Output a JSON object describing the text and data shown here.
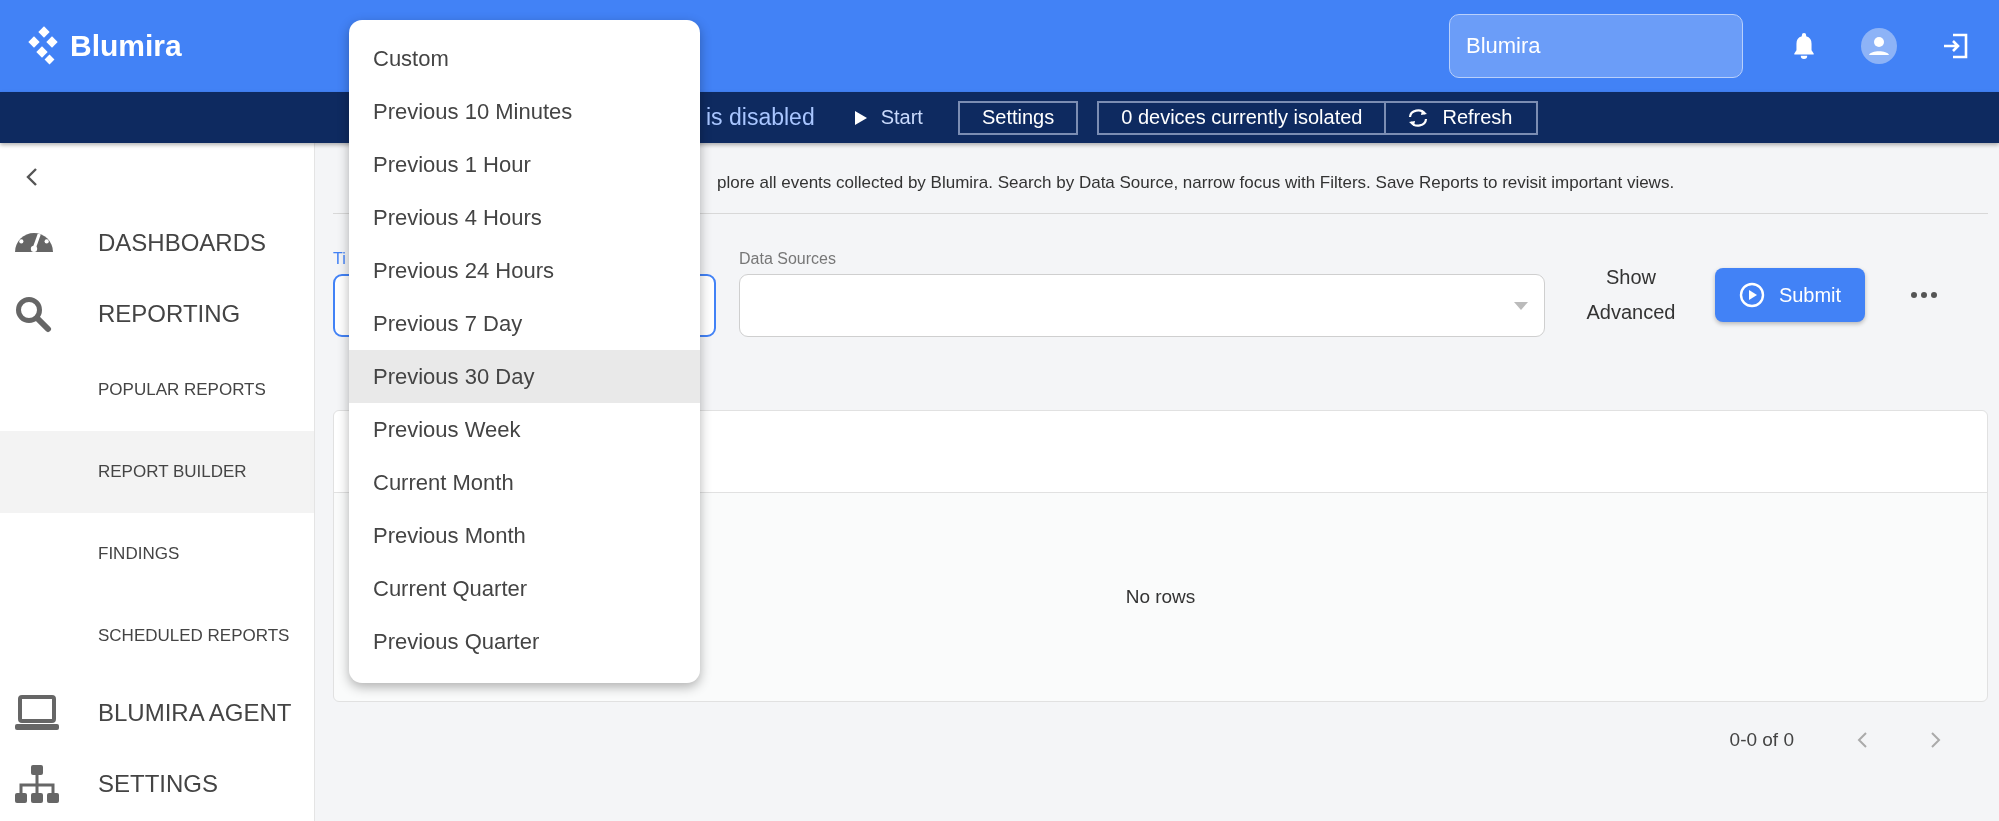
{
  "header": {
    "logo_text": "Blumira",
    "org_field": {
      "value": "Blumira"
    }
  },
  "status_bar": {
    "message": "is disabled",
    "start": "Start",
    "settings": "Settings",
    "isolated": "0 devices currently isolated",
    "refresh": "Refresh"
  },
  "sidebar": {
    "items": [
      {
        "label": "DASHBOARDS",
        "selected": false
      },
      {
        "label": "REPORTING",
        "selected": false,
        "children": [
          {
            "label": "POPULAR REPORTS",
            "selected": false
          },
          {
            "label": "REPORT BUILDER",
            "selected": true
          },
          {
            "label": "FINDINGS",
            "selected": false
          },
          {
            "label": "SCHEDULED REPORTS",
            "selected": false
          }
        ]
      },
      {
        "label": "BLUMIRA AGENT",
        "selected": false
      },
      {
        "label": "SETTINGS",
        "selected": false
      }
    ]
  },
  "description": "plore all events collected by Blumira. Search by Data Source, narrow focus with Filters. Save Reports to revisit important views.",
  "filters": {
    "time_label": "Ti",
    "data_sources": {
      "label": "Data Sources"
    },
    "show_advanced": "Show Advanced",
    "submit": "Submit"
  },
  "table": {
    "empty_text": "No rows"
  },
  "pagination": {
    "range": "0-0 of 0"
  },
  "time_menu": {
    "items": [
      {
        "label": "Custom",
        "selected": false
      },
      {
        "label": "Previous 10 Minutes",
        "selected": false
      },
      {
        "label": "Previous 1 Hour",
        "selected": false
      },
      {
        "label": "Previous 4 Hours",
        "selected": false
      },
      {
        "label": "Previous 24 Hours",
        "selected": false
      },
      {
        "label": "Previous 7 Day",
        "selected": false
      },
      {
        "label": "Previous 30 Day",
        "selected": true
      },
      {
        "label": "Previous Week",
        "selected": false
      },
      {
        "label": "Current Month",
        "selected": false
      },
      {
        "label": "Previous Month",
        "selected": false
      },
      {
        "label": "Current Quarter",
        "selected": false
      },
      {
        "label": "Previous Quarter",
        "selected": false
      }
    ]
  }
}
